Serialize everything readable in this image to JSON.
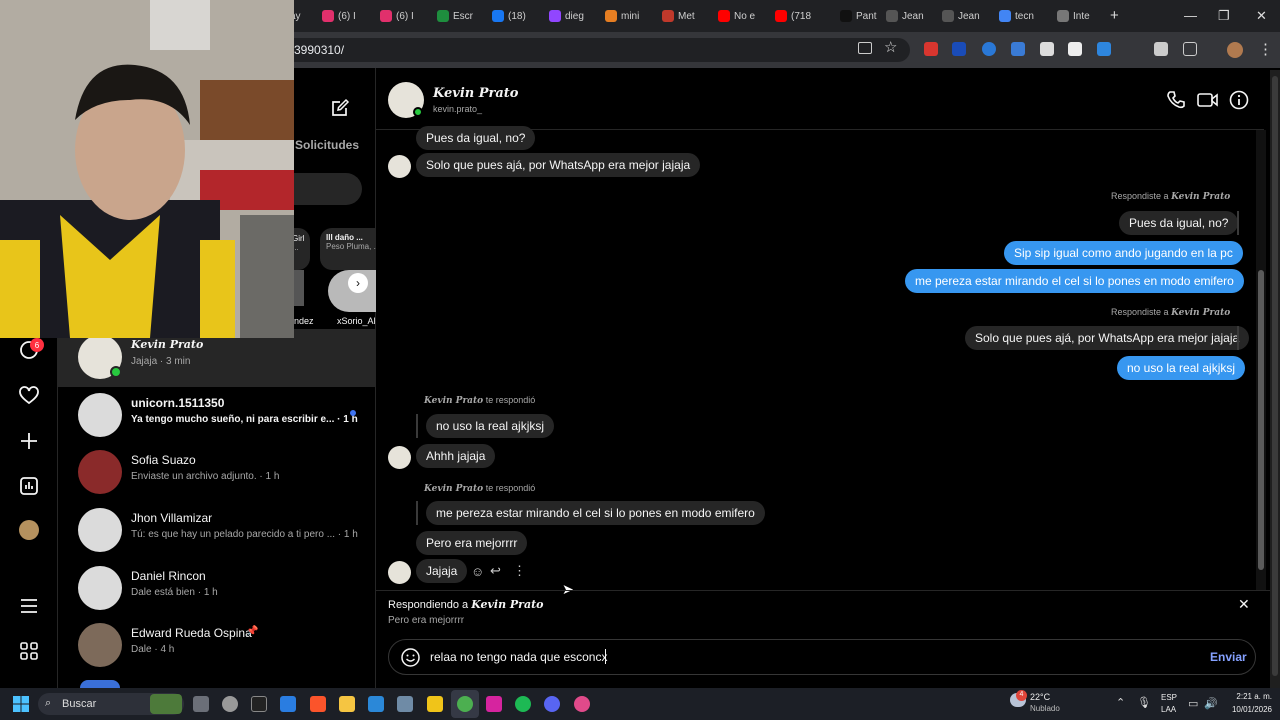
{
  "browser": {
    "tabs": [
      {
        "label": "ay",
        "color": "#444"
      },
      {
        "label": "(6) I",
        "color": "#e1306c"
      },
      {
        "label": "(6) I",
        "color": "#e1306c"
      },
      {
        "label": "Escr",
        "color": "#1e8e3e"
      },
      {
        "label": "(18)",
        "color": "#1877f2"
      },
      {
        "label": "dieg",
        "color": "#9146ff"
      },
      {
        "label": "mini",
        "color": "#e67e22"
      },
      {
        "label": "Met",
        "color": "#c0392b"
      },
      {
        "label": "No e",
        "color": "#ff0000"
      },
      {
        "label": "(718",
        "color": "#ff0000"
      },
      {
        "label": "Pant",
        "color": "#111"
      },
      {
        "label": "Jean",
        "color": "#555"
      },
      {
        "label": "Jean",
        "color": "#555"
      },
      {
        "label": "tecn",
        "color": "#4285f4"
      },
      {
        "label": "Inte",
        "color": "#777"
      }
    ],
    "new_tab": "+",
    "url_fragment": "3990310/"
  },
  "rail": {
    "notifications_badge": "6"
  },
  "conversation_list": {
    "requests_label": "Solicitudes",
    "notes": [
      {
        "title": "Girl",
        "sub": "..."
      },
      {
        "title": "lll daño ...",
        "sub": "Peso Pluma, ..."
      }
    ],
    "note_names": [
      "ndez",
      "xSorio_Al"
    ],
    "items": [
      {
        "name": "Kevin Prato",
        "preview": "Jajaja · 3 min",
        "avatar_color": "#e6e3da",
        "italic": true,
        "online": true,
        "unread": false
      },
      {
        "name": "unicorn.1511350",
        "preview": "Ya tengo mucho sueño, ni para escribir e... · 1 h",
        "avatar_color": "#dbdbdb",
        "italic": false,
        "online": false,
        "unread": true
      },
      {
        "name": "Sofia Suazo",
        "preview": "Enviaste un archivo adjunto. · 1 h",
        "avatar_color": "#8a2a2a",
        "italic": false,
        "online": false,
        "unread": false
      },
      {
        "name": "Jhon Villamizar",
        "preview": "Tú: es que hay un pelado parecido a ti pero ... · 1 h",
        "avatar_color": "#dbdbdb",
        "italic": false,
        "online": false,
        "unread": false
      },
      {
        "name": "Daniel Rincon",
        "preview": "Dale está bien · 1 h",
        "avatar_color": "#dbdbdb",
        "italic": false,
        "online": false,
        "unread": false
      },
      {
        "name": "Edward Rueda Ospina",
        "preview": "Dale · 4 h",
        "avatar_color": "#7d6a5a",
        "italic": false,
        "online": false,
        "unread": false
      }
    ]
  },
  "chat": {
    "contact_name": "Kevin Prato",
    "contact_username": "kevin.prato_",
    "messages": {
      "m1": "Pues da igual, no?",
      "m2": "Solo que pues ajá, por WhatsApp era mejor jajaja",
      "reply_label_1": "Respondiste a",
      "reply_name_1": "Kevin Prato",
      "m3": "Pues da igual, no?",
      "m4": "Sip sip igual como ando jugando en la pc",
      "m5": "me pereza estar mirando el cel si lo pones en modo emifero",
      "reply_label_2": "Respondiste a",
      "reply_name_2": "Kevin Prato",
      "m6": "Solo que pues ajá, por WhatsApp era mejor jajaja",
      "m7": "no uso la real ajkjksj",
      "reply_name_3": "Kevin Prato",
      "reply_label_3": "te respondió",
      "m8": "no uso la real ajkjksj",
      "m9": "Ahhh jajaja",
      "reply_name_4": "Kevin Prato",
      "reply_label_4": "te respondió",
      "m10": "me pereza estar mirando el cel si lo pones en modo emifero",
      "m11": "Pero era mejorrrr",
      "m12": "Jajaja"
    },
    "replying_to_label": "Respondiendo a",
    "replying_to_name": "Kevin Prato",
    "replying_to_text": "Pero era mejorrrr",
    "composer_value": "relaa no tengo nada que esconcx",
    "send_label": "Enviar"
  },
  "taskbar": {
    "search_placeholder": "Buscar",
    "weather_temp": "22°C",
    "weather_desc": "Nublado",
    "weather_badge": "4",
    "lang_1": "ESP",
    "lang_2": "LAA",
    "time": "2:21 a. m.",
    "date": "10/01/2026"
  }
}
